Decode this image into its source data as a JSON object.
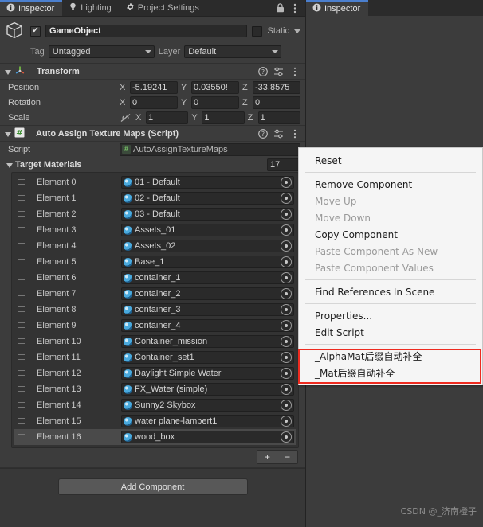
{
  "window": {
    "tabs": [
      {
        "label": "Inspector",
        "icon": "info-icon",
        "active": true
      },
      {
        "label": "Lighting",
        "icon": "bulb-icon",
        "active": false
      },
      {
        "label": "Project Settings",
        "icon": "gear-icon",
        "active": false
      }
    ],
    "lock_icon": "lock-icon",
    "kebab_icon": "kebab-menu-icon"
  },
  "right_panel": {
    "tab": {
      "label": "Inspector",
      "icon": "info-icon"
    }
  },
  "object_header": {
    "enabled_checkbox": "✔",
    "name": "GameObject",
    "static_label": "Static",
    "tag_label": "Tag",
    "tag_value": "Untagged",
    "layer_label": "Layer",
    "layer_value": "Default",
    "cube_icon": "gameobject-cube-icon"
  },
  "transform": {
    "title": "Transform",
    "icon": "transform-axis-icon",
    "help_icon": "help-icon",
    "preset_icon": "preset-icon",
    "kebab_icon": "kebab-menu-icon",
    "rows": [
      {
        "label": "Position",
        "x": "-5.19241",
        "y": "0.03550!",
        "z": "-33.8575"
      },
      {
        "label": "Rotation",
        "x": "0",
        "y": "0",
        "z": "0"
      },
      {
        "label": "Scale",
        "x": "1",
        "y": "1",
        "z": "1",
        "link_icon": "scale-link-off-icon"
      }
    ],
    "axis_labels": [
      "X",
      "Y",
      "Z"
    ]
  },
  "script_component": {
    "title": "Auto Assign Texture Maps (Script)",
    "icon": "cs-script-icon",
    "help_icon": "help-icon",
    "preset_icon": "preset-icon",
    "kebab_icon": "kebab-menu-icon",
    "script_label": "Script",
    "script_value": "AutoAssignTextureMaps",
    "array_label": "Target Materials",
    "array_size": "17",
    "add_button": "+",
    "remove_button": "−",
    "elements": [
      {
        "label": "Element 0",
        "value": "01 - Default"
      },
      {
        "label": "Element 1",
        "value": "02 - Default"
      },
      {
        "label": "Element 2",
        "value": "03 - Default"
      },
      {
        "label": "Element 3",
        "value": "Assets_01"
      },
      {
        "label": "Element 4",
        "value": "Assets_02"
      },
      {
        "label": "Element 5",
        "value": "Base_1"
      },
      {
        "label": "Element 6",
        "value": "container_1"
      },
      {
        "label": "Element 7",
        "value": "container_2"
      },
      {
        "label": "Element 8",
        "value": "container_3"
      },
      {
        "label": "Element 9",
        "value": "container_4"
      },
      {
        "label": "Element 10",
        "value": "Container_mission"
      },
      {
        "label": "Element 11",
        "value": "Container_set1"
      },
      {
        "label": "Element 12",
        "value": "Daylight Simple Water"
      },
      {
        "label": "Element 13",
        "value": "FX_Water (simple)"
      },
      {
        "label": "Element 14",
        "value": "Sunny2 Skybox"
      },
      {
        "label": "Element 15",
        "value": "water plane-lambert1"
      },
      {
        "label": "Element 16",
        "value": "wood_box",
        "selected": true
      }
    ]
  },
  "add_component_button": "Add Component",
  "context_menu": {
    "items": [
      {
        "label": "Reset",
        "enabled": true
      },
      {
        "separator": true
      },
      {
        "label": "Remove Component",
        "enabled": true
      },
      {
        "label": "Move Up",
        "enabled": false
      },
      {
        "label": "Move Down",
        "enabled": false
      },
      {
        "label": "Copy Component",
        "enabled": true
      },
      {
        "label": "Paste Component As New",
        "enabled": false
      },
      {
        "label": "Paste Component Values",
        "enabled": false
      },
      {
        "separator": true
      },
      {
        "label": "Find References In Scene",
        "enabled": true
      },
      {
        "separator": true
      },
      {
        "label": "Properties...",
        "enabled": true
      },
      {
        "label": "Edit Script",
        "enabled": true
      },
      {
        "separator": true
      },
      {
        "label": "_AlphaMat后缀自动补全",
        "enabled": true,
        "highlighted": true
      },
      {
        "label": "_Mat后缀自动补全",
        "enabled": true,
        "highlighted": true
      }
    ],
    "highlight_color": "#ee2b20"
  },
  "watermark": "CSDN @_济南橙子",
  "colors": {
    "panel_bg": "#383838",
    "component_bg": "#3c3c3c",
    "field_bg": "#2a2a2a",
    "tab_active_accent": "#4b7fce",
    "menu_bg": "#f5f5f5",
    "highlight_red": "#ee2b20"
  }
}
